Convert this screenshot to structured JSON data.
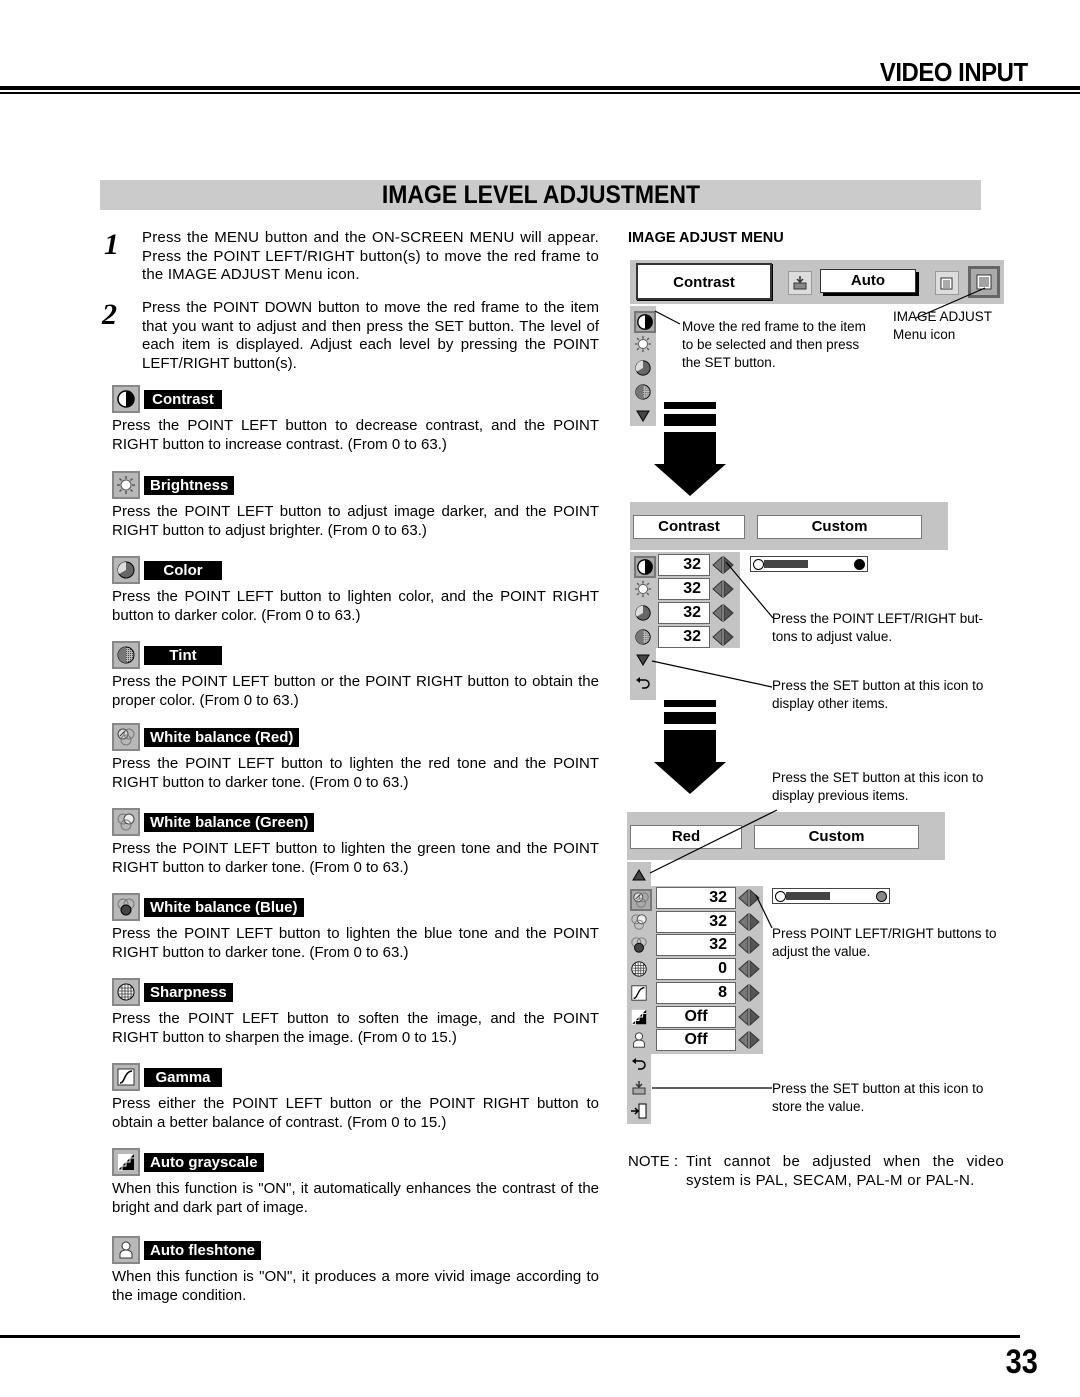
{
  "header": {
    "section_title": "VIDEO INPUT",
    "banner_title": "IMAGE LEVEL ADJUSTMENT"
  },
  "steps": [
    {
      "number": "1",
      "text": "Press the MENU button and the ON-SCREEN MENU will appear.  Press the POINT LEFT/RIGHT button(s) to move the red frame to the IMAGE ADJUST Menu icon."
    },
    {
      "number": "2",
      "text": "Press the POINT DOWN button to move the red frame to the item that you want to adjust and then press the SET button.  The level of each item is displayed.  Adjust each level by pressing the POINT LEFT/RIGHT button(s)."
    }
  ],
  "items": [
    {
      "icon": "contrast-icon",
      "label": "Contrast",
      "desc": "Press the POINT LEFT button to decrease contrast, and the POINT RIGHT button to increase contrast.  (From 0 to 63.)"
    },
    {
      "icon": "brightness-icon",
      "label": "Brightness",
      "desc": "Press the POINT LEFT button to adjust image darker, and the POINT RIGHT button to adjust brighter.  (From 0 to 63.)"
    },
    {
      "icon": "color-icon",
      "label": "Color",
      "desc": "Press the POINT LEFT button to lighten color, and the POINT RIGHT button to darker color.  (From 0 to 63.)"
    },
    {
      "icon": "tint-icon",
      "label": "Tint",
      "desc": "Press the POINT LEFT button or the POINT RIGHT button to obtain the proper color.  (From 0 to 63.)"
    },
    {
      "icon": "white-balance-red-icon",
      "label": "White balance (Red)",
      "desc": "Press the POINT LEFT button to lighten the red tone and the POINT RIGHT button to darker tone.  (From 0 to 63.)"
    },
    {
      "icon": "white-balance-green-icon",
      "label": "White balance (Green)",
      "desc": "Press the POINT LEFT button to lighten the green tone and the POINT RIGHT button to darker tone.  (From 0 to 63.)"
    },
    {
      "icon": "white-balance-blue-icon",
      "label": "White balance (Blue)",
      "desc": "Press the POINT LEFT button to lighten the blue tone and the POINT RIGHT button to darker tone.  (From 0 to 63.)"
    },
    {
      "icon": "sharpness-icon",
      "label": "Sharpness",
      "desc": "Press the POINT LEFT button to soften the image, and the POINT RIGHT button to sharpen the image.  (From 0 to 15.)"
    },
    {
      "icon": "gamma-icon",
      "label": "Gamma",
      "desc": "Press either the POINT LEFT button or the POINT RIGHT button to obtain a better balance of contrast.  (From 0 to 15.)"
    },
    {
      "icon": "auto-grayscale-icon",
      "label": "Auto grayscale",
      "desc": "When this function is \"ON\", it automatically enhances the contrast of the bright and dark part of image."
    },
    {
      "icon": "auto-fleshtone-icon",
      "label": "Auto fleshtone",
      "desc": "When this function is \"ON\", it produces a more vivid image according to the image condition."
    }
  ],
  "right_panel": {
    "title": "IMAGE ADJUST MENU",
    "menu1": {
      "field_label": "Contrast",
      "mode_value": "Auto",
      "callout_select": "Move the red frame to the item to be selected and then press the SET button.",
      "callout_icon": "IMAGE ADJUST Menu icon"
    },
    "menu2": {
      "field_label": "Contrast",
      "mode_value": "Custom",
      "values": [
        "32",
        "32",
        "32",
        "32"
      ],
      "slider_fraction": 0.5,
      "callout_adjust": "Press the POINT LEFT/RIGHT but-tons to adjust value.",
      "callout_next": "Press the SET button at this icon to display other items."
    },
    "menu3": {
      "field_label": "Red",
      "mode_value": "Custom",
      "values": [
        "32",
        "32",
        "32",
        "0",
        "8",
        "Off",
        "Off"
      ],
      "slider_fraction": 0.5,
      "callout_prev": "Press the SET button at this icon to display previous items.",
      "callout_adjust": "Press POINT LEFT/RIGHT buttons to adjust the value.",
      "callout_store": "Press the SET button at this icon to store the value."
    },
    "note_label": "NOTE :",
    "note_text": "Tint cannot be adjusted when the video system is PAL, SECAM, PAL-M or PAL-N."
  },
  "footer": {
    "page_number": "33"
  }
}
